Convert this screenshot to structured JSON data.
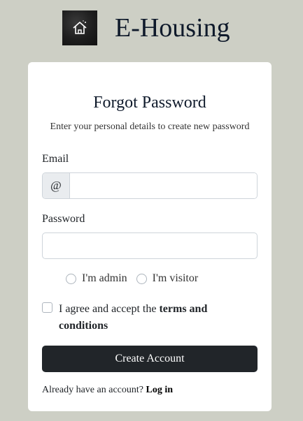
{
  "brand": {
    "title": "E-Housing",
    "logo_icon": "house-icon"
  },
  "form": {
    "title": "Forgot Password",
    "subtitle": "Enter your personal details to create new password",
    "email_label": "Email",
    "email_addon": "@",
    "email_value": "",
    "password_label": "Password",
    "password_value": "",
    "roles": [
      {
        "label": "I'm admin",
        "checked": false
      },
      {
        "label": "I'm visitor",
        "checked": false
      }
    ],
    "agree_prefix": "I agree and accept the ",
    "agree_link": "terms and conditions",
    "agree_checked": false,
    "submit_label": "Create Account",
    "login_prompt": "Already have an account? ",
    "login_link": "Log in"
  },
  "colors": {
    "background": "#cdcfc5",
    "card": "#ffffff",
    "button": "#212529",
    "title": "#0f1a2b"
  }
}
